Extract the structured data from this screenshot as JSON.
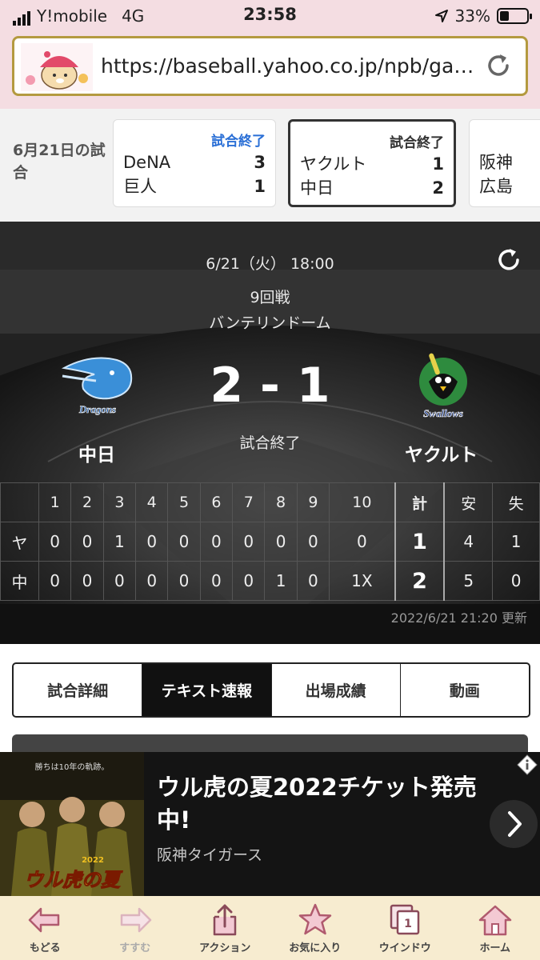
{
  "status_bar": {
    "carrier": "Y!mobile",
    "network": "4G",
    "time": "23:58",
    "battery": "33%"
  },
  "browser": {
    "url": "https://baseball.yahoo.co.jp/npb/ga…"
  },
  "games_strip": {
    "date_label": "6月21日の試合",
    "games": [
      {
        "status": "試合終了",
        "home": "DeNA",
        "home_score": "3",
        "away": "巨人",
        "away_score": "1"
      },
      {
        "status": "試合終了",
        "home": "ヤクルト",
        "home_score": "1",
        "away": "中日",
        "away_score": "2"
      },
      {
        "status": "",
        "home": "阪神",
        "home_score": "",
        "away": "広島",
        "away_score": ""
      }
    ]
  },
  "game": {
    "date": "6/21（火） 18:00",
    "round": "9回戦",
    "venue": "バンテリンドーム",
    "score": "2 - 1",
    "state": "試合終了",
    "home_team": "中日",
    "away_team": "ヤクルト",
    "home_logo_text": "Dragons",
    "away_logo_text": "Swallows"
  },
  "linescore": {
    "headers": [
      "",
      "1",
      "2",
      "3",
      "4",
      "5",
      "6",
      "7",
      "8",
      "9",
      "10",
      "計",
      "安",
      "失"
    ],
    "rows": [
      {
        "team": "ヤ",
        "innings": [
          "0",
          "0",
          "1",
          "0",
          "0",
          "0",
          "0",
          "0",
          "0",
          "0"
        ],
        "total": "1",
        "hits": "4",
        "errors": "1"
      },
      {
        "team": "中",
        "innings": [
          "0",
          "0",
          "0",
          "0",
          "0",
          "0",
          "0",
          "1",
          "0",
          "1X"
        ],
        "total": "2",
        "hits": "5",
        "errors": "0"
      }
    ],
    "updated": "2022/6/21 21:20 更新"
  },
  "tabs": [
    "試合詳細",
    "テキスト速報",
    "出場成績",
    "動画"
  ],
  "active_tab": "テキスト速報",
  "ad": {
    "headline": "ウル虎の夏2022チケット発売中!",
    "sponsor": "阪神タイガース",
    "image_caption": "ウル虎の夏",
    "image_tagline": "勝ちは10年の軌跡。",
    "image_year": "2022"
  },
  "toolbar": [
    "もどる",
    "すすむ",
    "アクション",
    "お気に入り",
    "ウインドウ",
    "ホーム"
  ],
  "window_count": "1"
}
